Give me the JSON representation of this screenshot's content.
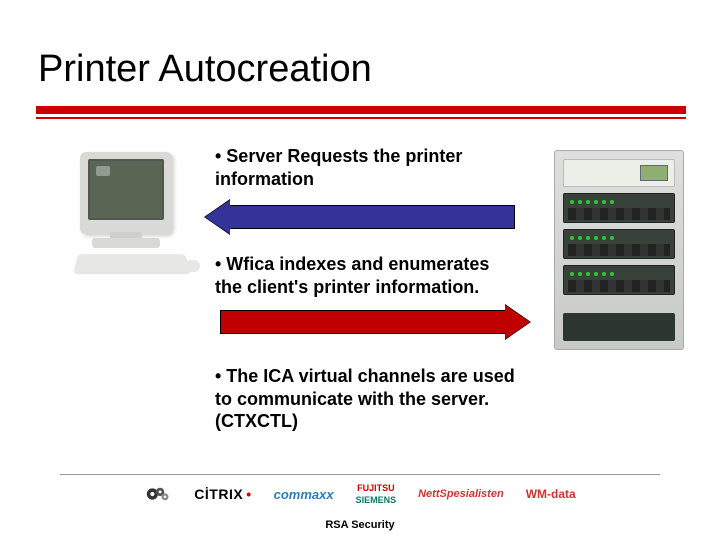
{
  "title": "Printer Autocreation",
  "bullets": {
    "b1": "• Server Requests the printer information",
    "b2": "• Wfica indexes and enumerates the client's printer information.",
    "b3": "• The ICA virtual channels are used to communicate with the server. (CTXCTL)"
  },
  "footer": {
    "logos": {
      "cog": "",
      "citrix": "CİTRIX",
      "commaxx": "commaxx",
      "fujitsu_top": "FUJITSU",
      "fujitsu_bot": "SIEMENS",
      "nett": "NettSpesialisten",
      "wm": "WM-data"
    },
    "rsa": "RSA Security"
  }
}
